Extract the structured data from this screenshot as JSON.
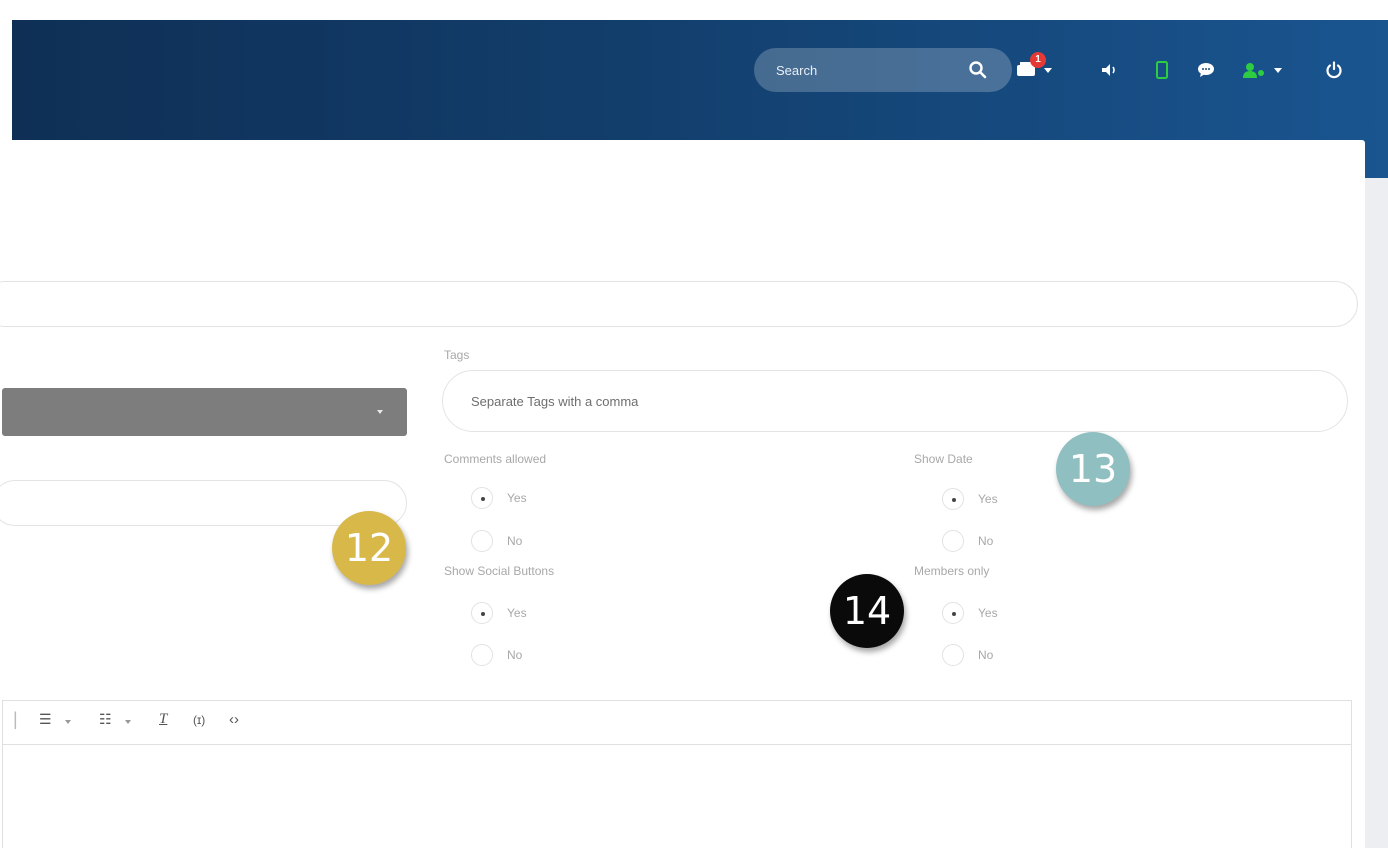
{
  "header": {
    "search_placeholder": "Search",
    "notification_count": "1",
    "icons": [
      "search-icon",
      "notification-icon",
      "speaker-icon",
      "mobile-icon",
      "chat-icon",
      "user-icon",
      "power-icon"
    ],
    "colors": {
      "bar_start": "#0f2f55",
      "bar_end": "#1a5590",
      "badge": "#e53935",
      "status_green": "#2ecc40"
    }
  },
  "form": {
    "tags": {
      "label": "Tags",
      "placeholder": "Separate Tags with a comma"
    },
    "comments_allowed": {
      "label": "Comments allowed",
      "options": [
        "Yes",
        "No"
      ],
      "selected": "Yes"
    },
    "show_date": {
      "label": "Show Date",
      "options": [
        "Yes",
        "No"
      ],
      "selected": "Yes"
    },
    "show_social_buttons": {
      "label": "Show Social Buttons",
      "options": [
        "Yes",
        "No"
      ],
      "selected": "Yes"
    },
    "members_only": {
      "label": "Members only",
      "options": [
        "Yes",
        "No"
      ],
      "selected": "Yes"
    }
  },
  "editor": {
    "toolbar": [
      "divider",
      "bulleted-list-icon",
      "numbered-list-icon",
      "clear-format-icon",
      "placeholder-icon",
      "source-code-icon"
    ],
    "tool_glyphs": {
      "bulleted_list": "☰",
      "numbered_list": "☷",
      "clear_format": "T",
      "placeholder": "(ɪ)",
      "source_code": "‹›"
    }
  },
  "markers": [
    {
      "label": "12",
      "color": "#d9b84a"
    },
    {
      "label": "13",
      "color": "#8fbfc0"
    },
    {
      "label": "14",
      "color": "#0a0a0a"
    }
  ]
}
